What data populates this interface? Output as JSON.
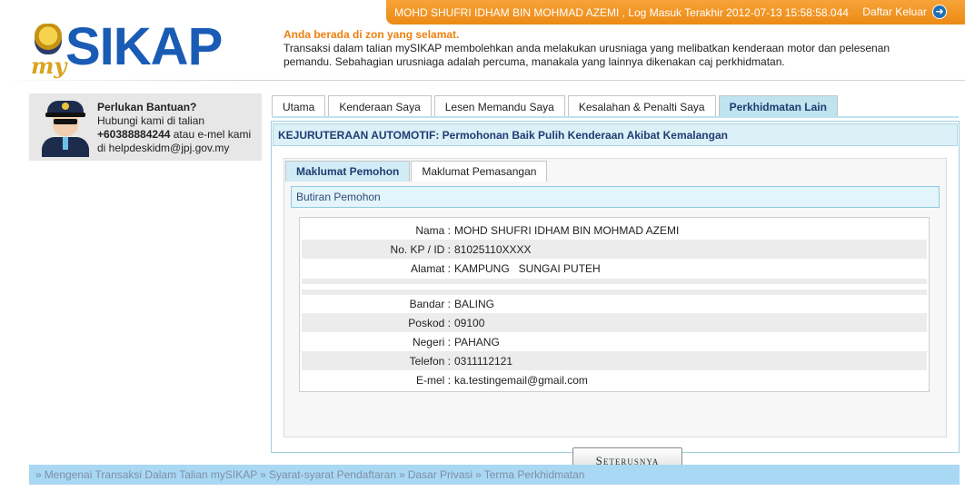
{
  "header": {
    "user_info": "MOHD SHUFRI IDHAM BIN MOHMAD AZEMI , Log Masuk Terakhir 2012-07-13 15:58:58.044",
    "logout_label": "Daftar Keluar",
    "accent_color": "#ec8a14"
  },
  "logo": {
    "my": "my",
    "name": "SIKAP"
  },
  "intro": {
    "safe_zone": "Anda berada di zon yang selamat.",
    "description": "Transaksi dalam talian mySIKAP membolehkan anda melakukan urusniaga yang melibatkan kenderaan motor dan pelesenan pemandu. Sebahagian urusniaga adalah percuma, manakala yang lainnya dikenakan caj perkhidmatan."
  },
  "help": {
    "title": "Perlukan Bantuan?",
    "line1": "Hubungi kami di talian",
    "phone": "+60388884244",
    "line2_suffix": " atau e-mel kami",
    "line3": "di helpdeskidm@jpj.gov.my"
  },
  "tabs": [
    "Utama",
    "Kenderaan Saya",
    "Lesen Memandu Saya",
    "Kesalahan & Penalti Saya",
    "Perkhidmatan Lain"
  ],
  "active_tab": "Perkhidmatan Lain",
  "panel": {
    "title": "KEJURUTERAAN AUTOMOTIF: Permohonan Baik Pulih Kenderaan Akibat Kemalangan",
    "subtabs": [
      "Maklumat Pemohon",
      "Maklumat Pemasangan"
    ],
    "section_title": "Butiran Pemohon",
    "fields": {
      "nama": {
        "label": "Nama :",
        "value": "MOHD SHUFRI IDHAM BIN MOHMAD AZEMI"
      },
      "kp": {
        "label": "No. KP / ID :",
        "value": "81025110XXXX"
      },
      "alamat": {
        "label": "Alamat :",
        "value": "KAMPUNG   SUNGAI PUTEH"
      },
      "bandar": {
        "label": "Bandar :",
        "value": "BALING"
      },
      "poskod": {
        "label": "Poskod :",
        "value": "09100"
      },
      "negeri": {
        "label": "Negeri :",
        "value": "PAHANG"
      },
      "telefon": {
        "label": "Telefon :",
        "value": "0311112121"
      },
      "emel": {
        "label": "E-mel :",
        "value": "ka.testingemail@gmail.com"
      }
    },
    "next_button": "Seterusnya"
  },
  "footer": {
    "links": [
      "Mengenai Transaksi Dalam Talian mySIKAP",
      "Syarat-syarat Pendaftaran",
      "Dasar Privasi",
      "Terma Perkhidmatan"
    ],
    "separator": "»"
  }
}
